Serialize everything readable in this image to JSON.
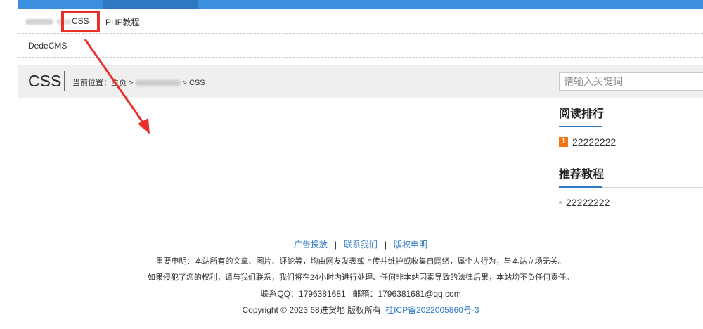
{
  "nav": {
    "items": [
      {
        "label": "CSS"
      },
      {
        "label": "PHP教程"
      }
    ],
    "row2": [
      {
        "label": "DedeCMS"
      }
    ]
  },
  "page": {
    "title": "CSS",
    "breadcrumb_prefix": "当前位置：",
    "home": "主页",
    "sep1": ">",
    "sep2": ">",
    "current": "CSS"
  },
  "search": {
    "placeholder": "请输入关键词"
  },
  "sidebar": {
    "reading_rank_title": "阅读排行",
    "reading_rank": [
      {
        "rank": "1",
        "title": "22222222"
      }
    ],
    "recommend_title": "推荐教程",
    "recommend": [
      {
        "title": "22222222"
      }
    ]
  },
  "footer": {
    "links": [
      {
        "label": "广告投放"
      },
      {
        "label": "联系我们"
      },
      {
        "label": "版权申明"
      }
    ],
    "divider": "|",
    "notice1": "重要申明：本站所有的文章、图片、评论等，均由网友发表或上传并维护或收集自网络，属个人行为，与本站立场无关。",
    "notice2": "如果侵犯了您的权利，请与我们联系，我们将在24小时内进行处理、任何非本站因素导致的法律后果，本站均不负任何责任。",
    "contact": "联系QQ：1796381681 | 邮箱：1796381681@qq.com",
    "copyright": "Copyright © 2023 68进货地 版权所有",
    "icp": "桂ICP备2022005860号-3"
  },
  "colors": {
    "brand": "#3c8ede",
    "highlight": "#e8302a",
    "rank_badge": "#f07617",
    "link": "#2f78c4"
  }
}
